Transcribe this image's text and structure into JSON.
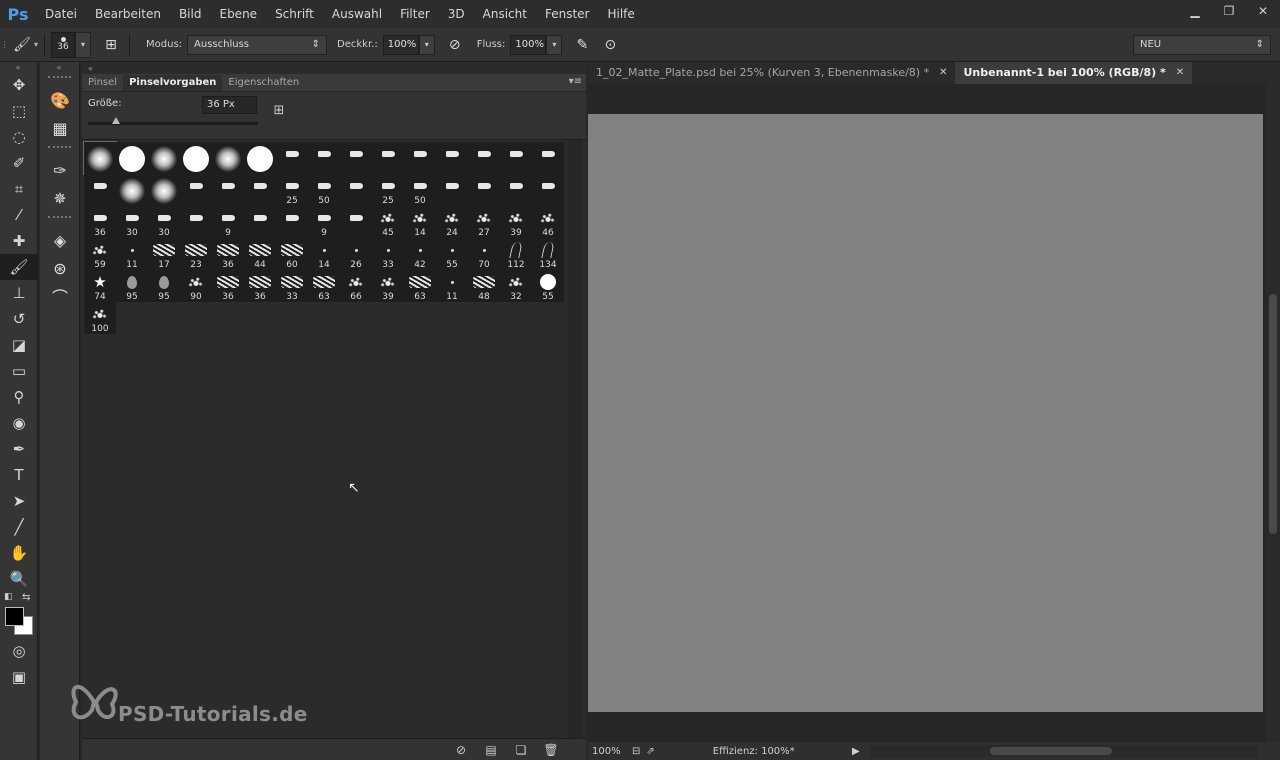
{
  "app": {
    "logo": "Ps"
  },
  "menu": [
    "Datei",
    "Bearbeiten",
    "Bild",
    "Ebene",
    "Schrift",
    "Auswahl",
    "Filter",
    "3D",
    "Ansicht",
    "Fenster",
    "Hilfe"
  ],
  "options": {
    "brush_size": "36",
    "mode_label": "Modus:",
    "mode_value": "Ausschluss",
    "opacity_label": "Deckkr.:",
    "opacity_value": "100%",
    "flow_label": "Fluss:",
    "flow_value": "100%",
    "workspace": "NEU"
  },
  "panel": {
    "tabs": [
      "Pinsel",
      "Pinselvorgaben",
      "Eigenschaften"
    ],
    "active_tab": "Pinselvorgaben",
    "size_label": "Größe:",
    "size_value": "36 Px"
  },
  "brushes": [
    {
      "t": "soft",
      "s": "",
      "n": ""
    },
    {
      "t": "hard",
      "s": "",
      "n": ""
    },
    {
      "t": "soft",
      "s": "",
      "n": ""
    },
    {
      "t": "hard",
      "s": "",
      "n": ""
    },
    {
      "t": "soft",
      "s": "",
      "n": ""
    },
    {
      "t": "hard",
      "s": "",
      "n": ""
    },
    {
      "t": "tip",
      "s": "",
      "n": ""
    },
    {
      "t": "tip",
      "s": "",
      "n": ""
    },
    {
      "t": "tip",
      "s": "",
      "n": ""
    },
    {
      "t": "tip",
      "s": "",
      "n": ""
    },
    {
      "t": "tip",
      "s": "",
      "n": ""
    },
    {
      "t": "tip",
      "s": "",
      "n": ""
    },
    {
      "t": "tip",
      "s": "",
      "n": ""
    },
    {
      "t": "tip",
      "s": "",
      "n": ""
    },
    {
      "t": "tip",
      "s": "",
      "n": ""
    },
    {
      "t": "tip",
      "s": "",
      "n": ""
    },
    {
      "t": "soft",
      "s": "",
      "n": ""
    },
    {
      "t": "soft",
      "s": "",
      "n": ""
    },
    {
      "t": "tip",
      "s": "",
      "n": ""
    },
    {
      "t": "tip",
      "s": "",
      "n": ""
    },
    {
      "t": "tip",
      "s": "",
      "n": ""
    },
    {
      "t": "tip",
      "s": "",
      "n": "25"
    },
    {
      "t": "tip",
      "s": "",
      "n": "50"
    },
    {
      "t": "tip",
      "s": "",
      "n": ""
    },
    {
      "t": "tip",
      "s": "",
      "n": "25"
    },
    {
      "t": "tip",
      "s": "",
      "n": "50"
    },
    {
      "t": "tip",
      "s": "",
      "n": ""
    },
    {
      "t": "tip",
      "s": "",
      "n": ""
    },
    {
      "t": "tip",
      "s": "",
      "n": ""
    },
    {
      "t": "tip",
      "s": "",
      "n": ""
    },
    {
      "t": "tip",
      "s": "",
      "n": "36"
    },
    {
      "t": "tip",
      "s": "",
      "n": "30"
    },
    {
      "t": "tip",
      "s": "",
      "n": "30"
    },
    {
      "t": "tip",
      "s": "",
      "n": ""
    },
    {
      "t": "tip",
      "s": "",
      "n": "9"
    },
    {
      "t": "tip",
      "s": "",
      "n": ""
    },
    {
      "t": "tip",
      "s": "",
      "n": ""
    },
    {
      "t": "tip",
      "s": "",
      "n": "9"
    },
    {
      "t": "tip",
      "s": "",
      "n": ""
    },
    {
      "t": "spatter",
      "s": "",
      "n": "45"
    },
    {
      "t": "spatter",
      "s": "",
      "n": "14"
    },
    {
      "t": "spatter",
      "s": "",
      "n": "24"
    },
    {
      "t": "spatter",
      "s": "",
      "n": "27"
    },
    {
      "t": "spatter",
      "s": "",
      "n": "39"
    },
    {
      "t": "spatter",
      "s": "",
      "n": "46"
    },
    {
      "t": "spatter",
      "s": "",
      "n": "59"
    },
    {
      "t": "dot",
      "s": "",
      "n": "11"
    },
    {
      "t": "chalk",
      "s": "",
      "n": "17"
    },
    {
      "t": "chalk",
      "s": "",
      "n": "23"
    },
    {
      "t": "chalk",
      "s": "",
      "n": "36"
    },
    {
      "t": "chalk",
      "s": "",
      "n": "44"
    },
    {
      "t": "chalk",
      "s": "",
      "n": "60"
    },
    {
      "t": "dot",
      "s": "",
      "n": "14"
    },
    {
      "t": "dot",
      "s": "",
      "n": "26"
    },
    {
      "t": "dot",
      "s": "",
      "n": "33"
    },
    {
      "t": "dot",
      "s": "",
      "n": "42"
    },
    {
      "t": "dot",
      "s": "",
      "n": "55"
    },
    {
      "t": "dot",
      "s": "",
      "n": "70"
    },
    {
      "t": "grass",
      "s": "",
      "n": "112"
    },
    {
      "t": "grass",
      "s": "",
      "n": "134"
    },
    {
      "t": "star",
      "s": "★",
      "n": "74"
    },
    {
      "t": "leaf",
      "s": "",
      "n": "95"
    },
    {
      "t": "leaf",
      "s": "",
      "n": "95"
    },
    {
      "t": "spatter",
      "s": "",
      "n": "90"
    },
    {
      "t": "chalk",
      "s": "",
      "n": "36"
    },
    {
      "t": "chalk",
      "s": "",
      "n": "36"
    },
    {
      "t": "chalk",
      "s": "",
      "n": "33"
    },
    {
      "t": "chalk",
      "s": "",
      "n": "63"
    },
    {
      "t": "spatter",
      "s": "",
      "n": "66"
    },
    {
      "t": "spatter",
      "s": "",
      "n": "39"
    },
    {
      "t": "chalk",
      "s": "",
      "n": "63"
    },
    {
      "t": "dot",
      "s": "",
      "n": "11"
    },
    {
      "t": "chalk",
      "s": "",
      "n": "48"
    },
    {
      "t": "spatter",
      "s": "",
      "n": "32"
    },
    {
      "t": "hard",
      "s": "",
      "n": "55"
    },
    {
      "t": "spatter",
      "s": "",
      "n": "100"
    }
  ],
  "document": {
    "tabs": [
      {
        "label": "1_02_Matte_Plate.psd bei 25% (Kurven 3, Ebenenmaske/8) *",
        "active": false
      },
      {
        "label": "Unbenannt-1 bei 100% (RGB/8) *",
        "active": true
      }
    ],
    "zoom": "100%",
    "status": "Effizienz: 100%*",
    "canvas_color": "#818181"
  },
  "watermark": {
    "text": "PSD-Tutorials.de"
  }
}
